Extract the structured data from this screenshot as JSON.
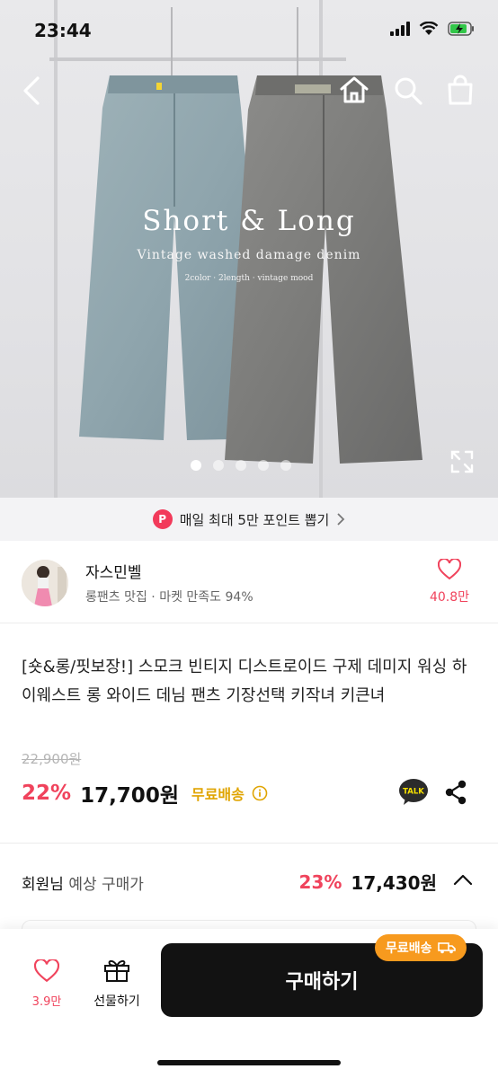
{
  "status": {
    "time": "23:44"
  },
  "hero": {
    "title": "Short & Long",
    "subtitle": "Vintage washed damage denim",
    "tags": "2color · 2length · vintage mood",
    "slides": 5,
    "active_slide": 1
  },
  "promo": {
    "badge": "P",
    "text": "매일 최대 5만 포인트 뽑기"
  },
  "seller": {
    "name": "자스민벨",
    "desc": "롱팬츠 맛집 · 마켓 만족도 94%",
    "likes": "40.8만"
  },
  "product": {
    "title": "[숏&롱/핏보장!] 스모크 빈티지 디스트로이드 구제 데미지 워싱 하이웨스트 롱 와이드 데님 팬츠 기장선택 키작녀 키큰녀",
    "original_price": "22,900원",
    "discount": "22%",
    "price": "17,700원",
    "shipping": "무료배송",
    "kakao_label": "TALK"
  },
  "member": {
    "label_strong": "회원님",
    "label_rest": " 예상 구매가",
    "discount": "23%",
    "price": "17,430원"
  },
  "bottom": {
    "likes": "3.9만",
    "gift_label": "선물하기",
    "buy_label": "구매하기",
    "ship_badge": "무료배송"
  },
  "colors": {
    "accent": "#f0435c",
    "ship": "#f79a1e",
    "buy": "#121212"
  }
}
